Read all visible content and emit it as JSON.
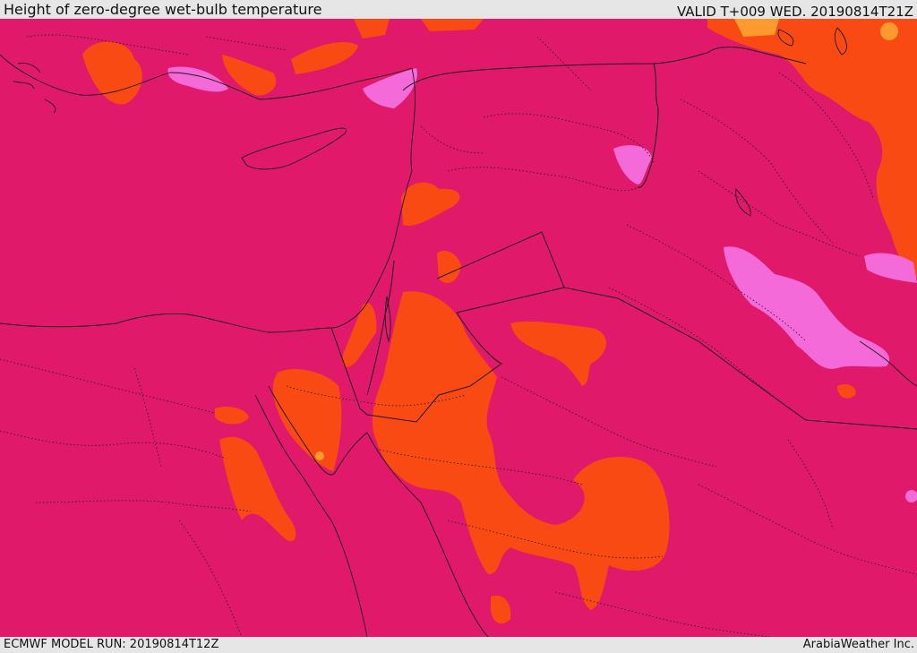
{
  "header": {
    "title": "Height of zero-degree wet-bulb temperature",
    "valid": "VALID T+009 WED. 20190814T21Z"
  },
  "footer": {
    "model_run": "ECMWF MODEL RUN: 20190814T12Z",
    "credit": "ArabiaWeather Inc."
  },
  "colors": {
    "background_field": "#e0196a",
    "high_orange": "#fa4a14",
    "peak_orange": "#ff9a2e",
    "low_pink": "#f46ad8",
    "borders": "#1a1a1a"
  }
}
